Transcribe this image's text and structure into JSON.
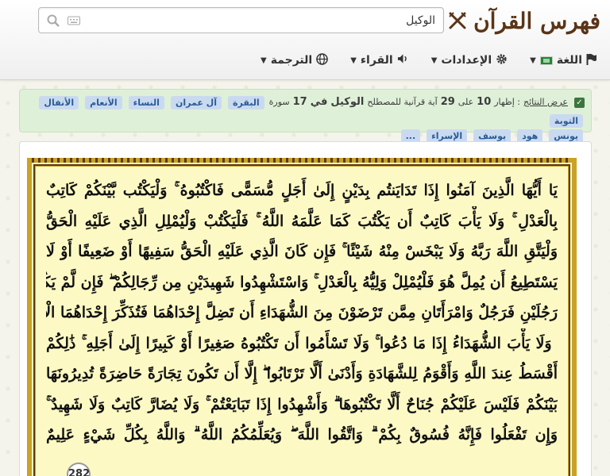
{
  "header": {
    "brand": "فهرس القرآن",
    "search": {
      "value": "الوكيل",
      "placeholder": ""
    }
  },
  "menu": {
    "translation": "الترجمة",
    "reciters": "القراء",
    "settings": "الإعدادات",
    "language": "اللغة"
  },
  "results": {
    "label": "عرض النتائج",
    "prefix": ": إظهار",
    "shown": "10",
    "on": "على",
    "total": "29",
    "verses_for_term": "آية قرآنية للمصطلح",
    "term": "الوكيل",
    "in": "في",
    "surah_count": "17",
    "surah_word": "سورة",
    "tags": [
      "البقرة",
      "آل عمران",
      "النساء",
      "الأنعام",
      "الأنفال",
      "التوبة",
      "يونس",
      "هود",
      "يوسف",
      "الإسراء",
      "..."
    ]
  },
  "mushaf": {
    "lines": [
      "يَا أَيُّهَا الَّذِينَ آمَنُوا إِذَا تَدَايَنتُم بِدَيْنٍ إِلَىٰ أَجَلٍ مُّسَمًّى فَاكْتُبُوهُ ۚ وَلْيَكْتُب بَّيْنَكُمْ كَاتِبٌ",
      "بِالْعَدْلِ ۚ وَلَا يَأْبَ كَاتِبٌ أَن يَكْتُبَ كَمَا عَلَّمَهُ اللَّهُ ۚ فَلْيَكْتُبْ وَلْيُمْلِلِ الَّذِي عَلَيْهِ الْحَقُّ",
      "وَلْيَتَّقِ اللَّهَ رَبَّهُ وَلَا يَبْخَسْ مِنْهُ شَيْئًا ۚ فَإِن كَانَ الَّذِي عَلَيْهِ الْحَقُّ سَفِيهًا أَوْ ضَعِيفًا أَوْ لَا",
      "يَسْتَطِيعُ أَن يُمِلَّ هُوَ فَلْيُمْلِلْ وَلِيُّهُ بِالْعَدْلِ ۚ وَاسْتَشْهِدُوا شَهِيدَيْنِ مِن رِّجَالِكُمْ ۖ فَإِن لَّمْ يَكُونَا",
      "رَجُلَيْنِ فَرَجُلٌ وَامْرَأَتَانِ مِمَّن تَرْضَوْنَ مِنَ الشُّهَدَاءِ أَن تَضِلَّ إِحْدَاهُمَا فَتُذَكِّرَ إِحْدَاهُمَا الْأُخْرَىٰ",
      "ۚ وَلَا يَأْبَ الشُّهَدَاءُ إِذَا مَا دُعُوا ۚ وَلَا تَسْأَمُوا أَن تَكْتُبُوهُ صَغِيرًا أَوْ كَبِيرًا إِلَىٰ أَجَلِهِ ۚ ذَٰلِكُمْ",
      "أَقْسَطُ عِندَ اللَّهِ وَأَقْوَمُ لِلشَّهَادَةِ وَأَدْنَىٰ أَلَّا تَرْتَابُوا ۖ إِلَّا أَن تَكُونَ تِجَارَةً حَاضِرَةً تُدِيرُونَهَا",
      "بَيْنَكُمْ فَلَيْسَ عَلَيْكُمْ جُنَاحٌ أَلَّا تَكْتُبُوهَا ۗ وَأَشْهِدُوا إِذَا تَبَايَعْتُمْ ۚ وَلَا يُضَارَّ كَاتِبٌ وَلَا شَهِيدٌ ۚ",
      "وَإِن تَفْعَلُوا فَإِنَّهُ فُسُوقٌ بِكُمْ ۗ وَاتَّقُوا اللَّهَ ۖ وَيُعَلِّمُكُمُ اللَّهُ ۗ وَاللَّهُ بِكُلِّ شَيْءٍ عَلِيمٌ"
    ],
    "page_number": "282"
  }
}
